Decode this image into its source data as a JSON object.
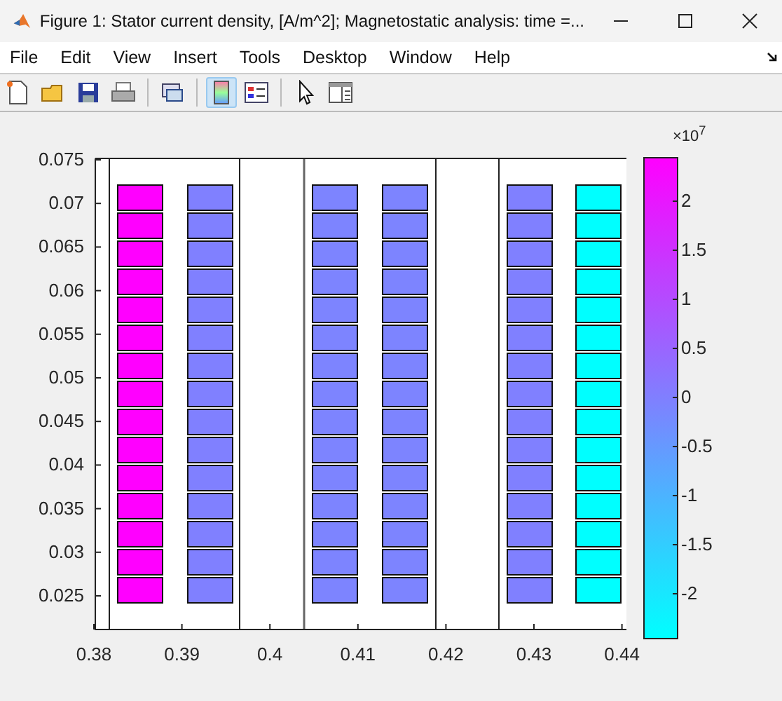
{
  "window": {
    "title": "Figure 1: Stator current density, [A/m^2]; Magnetostatic analysis: time =..."
  },
  "menu": [
    "File",
    "Edit",
    "View",
    "Insert",
    "Tools",
    "Desktop",
    "Window",
    "Help"
  ],
  "toolbar": [
    {
      "kind": "new"
    },
    {
      "kind": "open"
    },
    {
      "kind": "save"
    },
    {
      "kind": "print"
    },
    {
      "kind": "sep"
    },
    {
      "kind": "link"
    },
    {
      "kind": "sep"
    },
    {
      "kind": "colorbar",
      "selected": true
    },
    {
      "kind": "legend"
    },
    {
      "kind": "sep"
    },
    {
      "kind": "pointer"
    },
    {
      "kind": "inspector"
    }
  ],
  "plot": {
    "yticks": [
      "0.075",
      "0.07",
      "0.065",
      "0.06",
      "0.055",
      "0.05",
      "0.045",
      "0.04",
      "0.035",
      "0.03",
      "0.025"
    ],
    "xticks": [
      "0.38",
      "0.39",
      "0.4",
      "0.41",
      "0.42",
      "0.43",
      "0.44"
    ],
    "columns": [
      {
        "color": "#ff00ff"
      },
      {
        "color": "#8080ff"
      },
      {
        "color": "#7d84ff"
      },
      {
        "color": "#7d84ff"
      },
      {
        "color": "#8080ff"
      },
      {
        "color": "#00ffff"
      }
    ],
    "colorbar": {
      "multiplier": "×10$^{7}$",
      "ticks": [
        "2",
        "1.5",
        "1",
        "0.5",
        "0",
        "-0.5",
        "-1",
        "-1.5",
        "-2"
      ]
    }
  }
}
